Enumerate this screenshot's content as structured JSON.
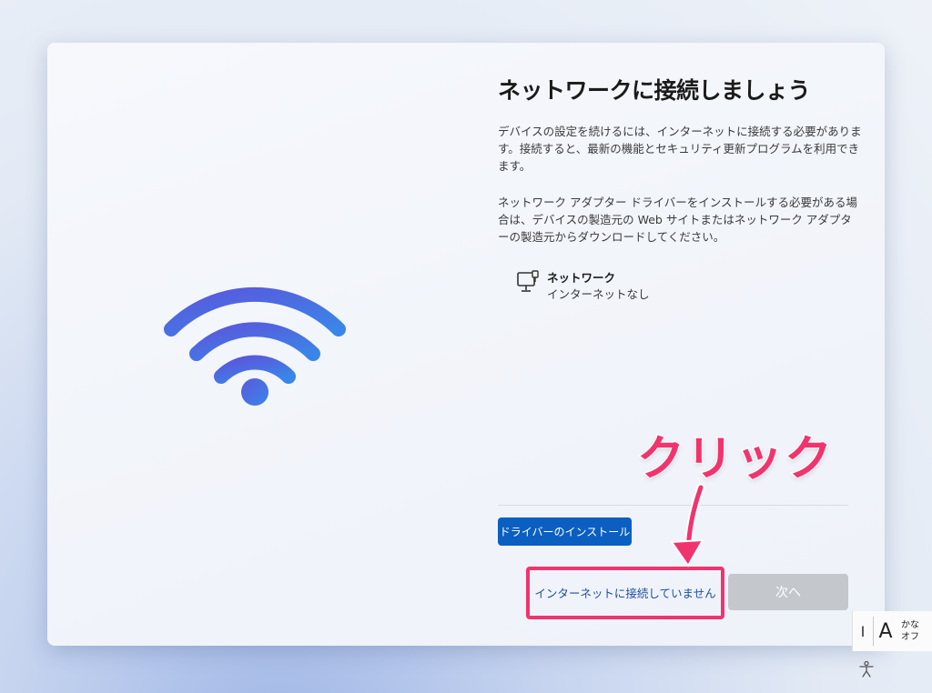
{
  "main": {
    "title": "ネットワークに接続しましょう",
    "paragraph1": "デバイスの設定を続けるには、インターネットに接続する必要があります。接続すると、最新の機能とセキュリティ更新プログラムを利用できます。",
    "paragraph2": "ネットワーク アダプター ドライバーをインストールする必要がある場合は、デバイスの製造元の Web サイトまたはネットワーク アダプターの製造元からダウンロードしてください。",
    "network": {
      "name": "ネットワーク",
      "status": "インターネットなし",
      "icon": "wired-network-icon"
    }
  },
  "buttons": {
    "install_driver": "ドライバーのインストール",
    "no_internet": "インターネットに接続していません",
    "next": "次へ"
  },
  "annotation": {
    "callout": "クリック",
    "color": "#f0346e"
  },
  "ime": {
    "cursor": "I",
    "letter": "A",
    "mode_line1": "かな",
    "mode_line2": "オフ"
  },
  "colors": {
    "accent": "#0a5fc1",
    "wifi_gradient": [
      "#4e5fe0",
      "#3f86e6"
    ]
  }
}
